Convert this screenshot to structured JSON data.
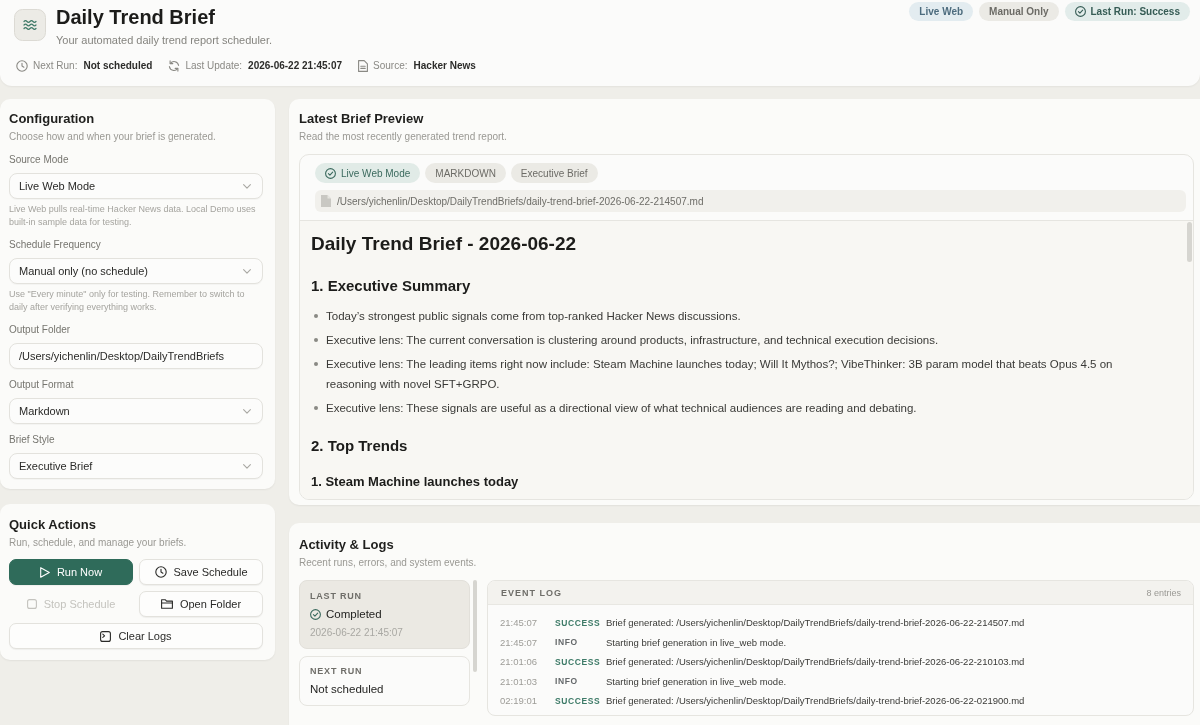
{
  "header": {
    "title": "Daily Trend Brief",
    "subtitle": "Your automated daily trend report scheduler.",
    "meta": [
      {
        "label": "Next Run:",
        "value": "Not scheduled"
      },
      {
        "label": "Last Update:",
        "value": "2026-06-22 21:45:07"
      },
      {
        "label": "Source:",
        "value": "Hacker News"
      }
    ],
    "badges": [
      {
        "label": "Live Web",
        "kind": "info"
      },
      {
        "label": "Manual Only",
        "kind": "neutral"
      },
      {
        "label": "Last Run: Success",
        "kind": "success"
      }
    ]
  },
  "configuration": {
    "title": "Configuration",
    "subtitle": "Choose how and when your brief is generated.",
    "fields": [
      {
        "label": "Source Mode",
        "kind": "select",
        "value": "Live Web Mode",
        "help": "Live Web pulls real-time Hacker News data. Local Demo uses built-in sample data for testing."
      },
      {
        "label": "Schedule Frequency",
        "kind": "select",
        "value": "Manual only (no schedule)",
        "help": "Use \"Every minute\" only for testing. Remember to switch to daily after verifying everything works."
      },
      {
        "label": "Output Folder",
        "kind": "text",
        "value": "/Users/yichenlin/Desktop/DailyTrendBriefs"
      },
      {
        "label": "Output Format",
        "kind": "select",
        "value": "Markdown"
      },
      {
        "label": "Brief Style",
        "kind": "select",
        "value": "Executive Brief"
      }
    ]
  },
  "quick_actions": {
    "title": "Quick Actions",
    "subtitle": "Run, schedule, and manage your briefs.",
    "buttons": [
      {
        "label": "Run Now",
        "kind": "primary",
        "disabled": false
      },
      {
        "label": "Save Schedule",
        "kind": "secondary",
        "disabled": false
      },
      {
        "label": "Stop Schedule",
        "kind": "secondary",
        "disabled": true
      },
      {
        "label": "Open Folder",
        "kind": "secondary",
        "disabled": false
      },
      {
        "label": "Clear Logs",
        "kind": "wide",
        "disabled": false
      }
    ]
  },
  "preview": {
    "title": "Latest Brief Preview",
    "subtitle": "Read the most recently generated trend report.",
    "chips": [
      {
        "label": "Live Web Mode",
        "kind": "success"
      },
      {
        "label": "MARKDOWN",
        "kind": "neutral"
      },
      {
        "label": "Executive Brief",
        "kind": "neutral"
      }
    ],
    "file_path": "/Users/yichenlin/Desktop/DailyTrendBriefs/daily-trend-brief-2026-06-22-214507.md",
    "document": [
      {
        "kind": "h1",
        "text": "Daily Trend Brief - 2026-06-22"
      },
      {
        "kind": "h2",
        "text": "1. Executive Summary"
      },
      {
        "kind": "list",
        "items": [
          "Today’s strongest public signals come from top-ranked Hacker News discussions.",
          "Executive lens: The current conversation is clustering around products, infrastructure, and technical execution decisions.",
          "Executive lens: The leading items right now include: Steam Machine launches today; Will It Mythos?; VibeThinker: 3B param model that beats Opus 4.5 on reasoning with novel SFT+GRPO.",
          "Executive lens: These signals are useful as a directional view of what technical audiences are reading and debating."
        ]
      },
      {
        "kind": "h2",
        "text": "2. Top Trends"
      },
      {
        "kind": "h3",
        "text": "1. Steam Machine launches today"
      }
    ]
  },
  "activity": {
    "title": "Activity & Logs",
    "subtitle": "Recent runs, errors, and system events.",
    "summary_cards": [
      {
        "label": "LAST RUN",
        "value": "Completed",
        "detail": "2026-06-22 21:45:07",
        "kind": "status",
        "selected": true
      },
      {
        "label": "NEXT RUN",
        "value": "Not scheduled",
        "kind": "plain",
        "selected": false
      }
    ],
    "event_log": {
      "title": "EVENT LOG",
      "count": "8 entries",
      "entries": [
        {
          "time": "21:45:07",
          "severity": "SUCCESS",
          "kind": "success",
          "message": "Brief generated: /Users/yichenlin/Desktop/DailyTrendBriefs/daily-trend-brief-2026-06-22-214507.md"
        },
        {
          "time": "21:45:07",
          "severity": "INFO",
          "kind": "info",
          "message": "Starting brief generation in live_web mode."
        },
        {
          "time": "21:01:06",
          "severity": "SUCCESS",
          "kind": "success",
          "message": "Brief generated: /Users/yichenlin/Desktop/DailyTrendBriefs/daily-trend-brief-2026-06-22-210103.md"
        },
        {
          "time": "21:01:03",
          "severity": "INFO",
          "kind": "info",
          "message": "Starting brief generation in live_web mode."
        },
        {
          "time": "02:19:01",
          "severity": "SUCCESS",
          "kind": "success",
          "message": "Brief generated: /Users/yichenlin/Desktop/DailyTrendBriefs/daily-trend-brief-2026-06-22-021900.md"
        }
      ]
    }
  }
}
